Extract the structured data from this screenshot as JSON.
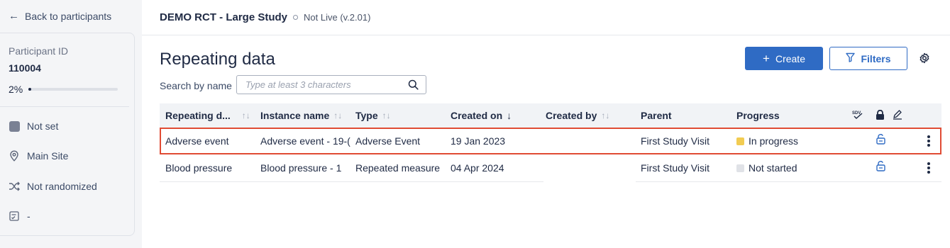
{
  "nav": {
    "back_label": "Back to participants"
  },
  "participant": {
    "id_label": "Participant ID",
    "id_value": "110004",
    "progress_text": "2%",
    "progress_fraction": 0.02,
    "status": "Not set",
    "site": "Main Site",
    "randomization": "Not randomized",
    "extra": "-"
  },
  "study": {
    "title": "DEMO RCT - Large Study",
    "status": "Not Live (v.2.01)"
  },
  "page": {
    "title": "Repeating data"
  },
  "toolbar": {
    "create_label": "Create",
    "filters_label": "Filters"
  },
  "search": {
    "label": "Search by name",
    "placeholder": "Type at least 3 characters"
  },
  "table": {
    "headers": {
      "repeating": "Repeating d...",
      "instance": "Instance name",
      "type": "Type",
      "created_on": "Created on",
      "created_by": "Created by",
      "parent": "Parent",
      "progress": "Progress",
      "sdv": "SDV"
    },
    "rows": [
      {
        "repeating": "Adverse event",
        "instance": "Adverse event - 19-(",
        "type": "Adverse Event",
        "created_on": "19 Jan 2023",
        "created_by": "",
        "parent": "First Study Visit",
        "progress": "In progress",
        "progress_color": "#f2cc52",
        "highlighted": true
      },
      {
        "repeating": "Blood pressure",
        "instance": "Blood pressure - 1",
        "type": "Repeated measure",
        "created_on": "04 Apr 2024",
        "created_by": "",
        "parent": "First Study Visit",
        "progress": "Not started",
        "progress_color": "#e0e2e7",
        "highlighted": false
      }
    ]
  },
  "colors": {
    "primary": "#2f6bc4",
    "highlight_border": "#e04b34",
    "in_progress": "#f2cc52",
    "not_started": "#e0e2e7"
  },
  "icons": {
    "back": "arrow-left-icon",
    "status": "status-square-icon",
    "site": "location-pin-icon",
    "randomization": "shuffle-icon",
    "extra": "checklist-icon",
    "create": "plus-icon",
    "filters": "funnel-icon",
    "settings": "gear-icon",
    "search": "search-icon",
    "sdv": "sdv-icon",
    "lock": "lock-icon",
    "sign": "pen-icon",
    "unlock": "unlock-icon",
    "more": "kebab-menu-icon"
  }
}
